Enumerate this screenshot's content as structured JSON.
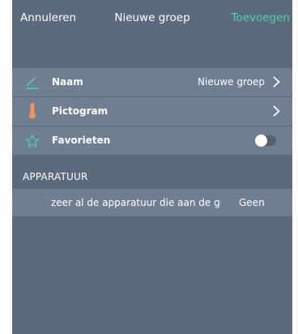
{
  "navbar": {
    "cancel_label": "Annuleren",
    "title": "Nieuwe groep",
    "add_label": "Toevoegen"
  },
  "rows": [
    {
      "icon": "pencil-icon",
      "label": "Naam",
      "value": "Nieuwe groep"
    },
    {
      "icon": "thermometer-icon",
      "label": "Pictogram",
      "value": ""
    },
    {
      "icon": "star-outline-icon",
      "label": "Favorieten",
      "toggle_on": false
    }
  ],
  "section": {
    "header": "APPARATUUR",
    "device_text": "zeer al de apparatuur die aan de gr",
    "device_value": "Geen"
  },
  "colors": {
    "background": "#5b6a7d",
    "row": "#6f7e91",
    "accent": "#4fd1a3",
    "icon_orange": "#f0965a"
  }
}
